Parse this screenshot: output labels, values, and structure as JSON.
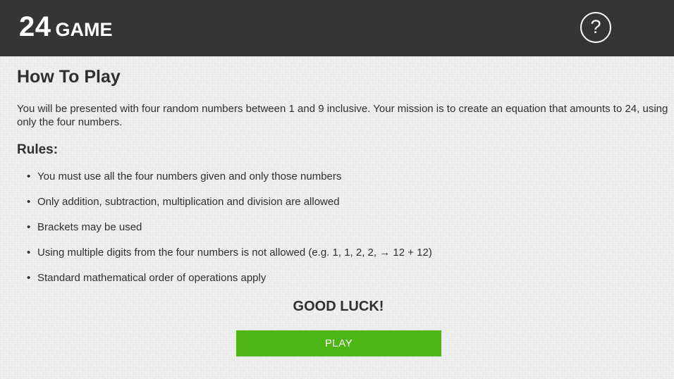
{
  "header": {
    "logo_number": "24",
    "logo_word": "GAME",
    "help_label": "?"
  },
  "colors": {
    "header_bg": "#353535",
    "play_button": "#4bb616",
    "text": "#2f2f2f"
  },
  "instructions": {
    "title": "How To Play",
    "intro": "You will be presented with four random numbers between 1 and 9 inclusive. Your mission is to create an equation that amounts to 24, using only the four numbers.",
    "rules_heading": "Rules:",
    "rules": [
      "You must use all the four numbers given and only those numbers",
      "Only addition, subtraction, multiplication and division are allowed",
      "Brackets may be used",
      "Using multiple digits from the four numbers is not allowed (e.g. 1, 1, 2, 2, → 12 + 12)",
      "Standard mathematical order of operations apply"
    ],
    "bullet": "•",
    "good_luck": "GOOD LUCK!"
  },
  "actions": {
    "play_label": "PLAY"
  },
  "icons": {
    "help": "question-mark-circle-icon"
  }
}
